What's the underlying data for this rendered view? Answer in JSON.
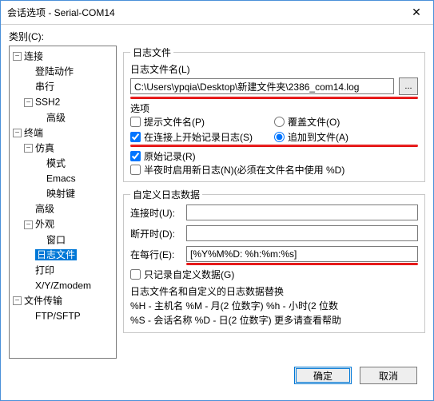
{
  "window": {
    "title": "会话选项 - Serial-COM14",
    "close": "✕"
  },
  "category_label": "类别(C):",
  "tree": {
    "connection": "连接",
    "login_actions": "登陆动作",
    "serial": "串行",
    "ssh2": "SSH2",
    "advanced": "高级",
    "terminal": "终端",
    "emulation": "仿真",
    "modes": "模式",
    "emacs": "Emacs",
    "mapped_keys": "映射键",
    "advanced2": "高级",
    "appearance": "外观",
    "window": "窗口",
    "logfile": "日志文件",
    "print": "打印",
    "xyzmodem": "X/Y/Zmodem",
    "file_transfer": "文件传输",
    "ftpsftp": "FTP/SFTP"
  },
  "logfile": {
    "group_title": "日志文件",
    "name_label": "日志文件名(L)",
    "path_value": "C:\\Users\\ypqia\\Desktop\\新建文件夹\\2386_com14.log",
    "browse": "...",
    "options_title": "选项",
    "prompt_filename": "提示文件名(P)",
    "overwrite_file": "覆盖文件(O)",
    "start_on_connect": "在连接上开始记录日志(S)",
    "append_to_file": "追加到文件(A)",
    "raw_log": "原始记录(R)",
    "new_log_midnight": "半夜时启用新日志(N)(必须在文件名中使用 %D)"
  },
  "custom": {
    "group_title": "自定义日志数据",
    "on_connect": "连接时(U):",
    "on_disconnect": "断开时(D):",
    "on_each_line": "在每行(E):",
    "each_line_value": "[%Y%M%D: %h:%m:%s]",
    "only_custom": "只记录自定义数据(G)",
    "subst_title": "日志文件名和自定义的日志数据替换",
    "subst_line1": "%H - 主机名        %M - 月(2 位数字)    %h - 小时(2 位数",
    "subst_line2": "%S - 会话名称    %D - 日(2 位数字)    更多请查看帮助"
  },
  "buttons": {
    "ok": "确定",
    "cancel": "取消"
  }
}
